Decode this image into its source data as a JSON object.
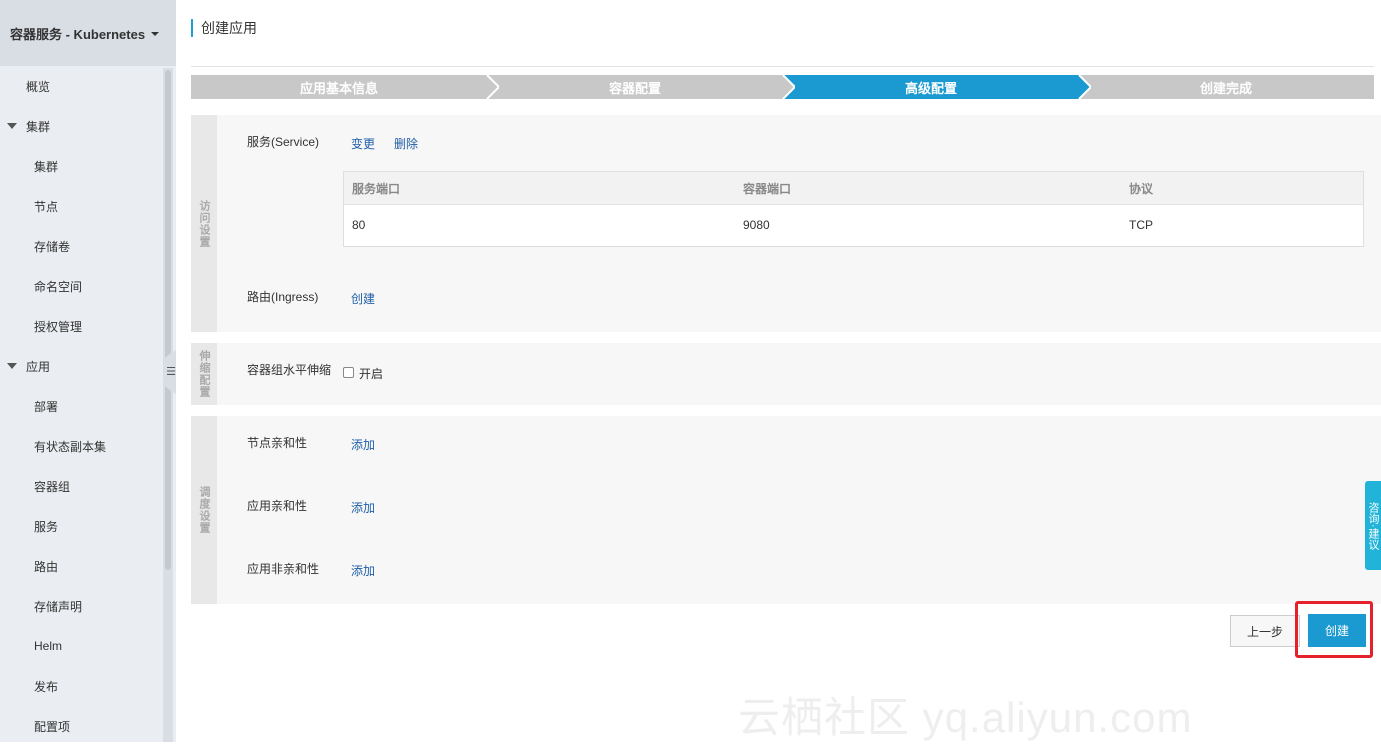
{
  "sidebar": {
    "title": "容器服务 - Kubernetes",
    "items": [
      {
        "label": "概览",
        "type": "top"
      },
      {
        "label": "集群",
        "type": "group"
      },
      {
        "label": "集群",
        "type": "sub"
      },
      {
        "label": "节点",
        "type": "sub"
      },
      {
        "label": "存储卷",
        "type": "sub"
      },
      {
        "label": "命名空间",
        "type": "sub"
      },
      {
        "label": "授权管理",
        "type": "sub"
      },
      {
        "label": "应用",
        "type": "group"
      },
      {
        "label": "部署",
        "type": "sub"
      },
      {
        "label": "有状态副本集",
        "type": "sub"
      },
      {
        "label": "容器组",
        "type": "sub"
      },
      {
        "label": "服务",
        "type": "sub"
      },
      {
        "label": "路由",
        "type": "sub"
      },
      {
        "label": "存储声明",
        "type": "sub"
      },
      {
        "label": "Helm",
        "type": "sub"
      },
      {
        "label": "发布",
        "type": "sub"
      },
      {
        "label": "配置项",
        "type": "sub"
      }
    ]
  },
  "page": {
    "title": "创建应用"
  },
  "steps": [
    {
      "label": "应用基本信息",
      "active": false
    },
    {
      "label": "容器配置",
      "active": false
    },
    {
      "label": "高级配置",
      "active": true
    },
    {
      "label": "创建完成",
      "active": false
    }
  ],
  "access": {
    "section": "访问设置",
    "service_label": "服务(Service)",
    "change": "变更",
    "delete": "删除",
    "table": {
      "headers": [
        "服务端口",
        "容器端口",
        "协议"
      ],
      "rows": [
        [
          "80",
          "9080",
          "TCP"
        ]
      ]
    },
    "ingress_label": "路由(Ingress)",
    "ingress_create": "创建"
  },
  "scaling": {
    "section": "伸缩配置",
    "hpa_label": "容器组水平伸缩",
    "enable_label": "开启"
  },
  "scheduling": {
    "section": "调度设置",
    "node_affinity": "节点亲和性",
    "app_affinity": "应用亲和性",
    "app_anti_affinity": "应用非亲和性",
    "add": "添加"
  },
  "buttons": {
    "prev": "上一步",
    "create": "创建"
  },
  "feedback": "咨询·建议",
  "watermark": "云栖社区 yq.aliyun.com",
  "colors": {
    "accent": "#1a9ad0",
    "step_inactive": "#c8c8c8",
    "link": "#1f5ea8",
    "highlight": "#e5212b"
  }
}
